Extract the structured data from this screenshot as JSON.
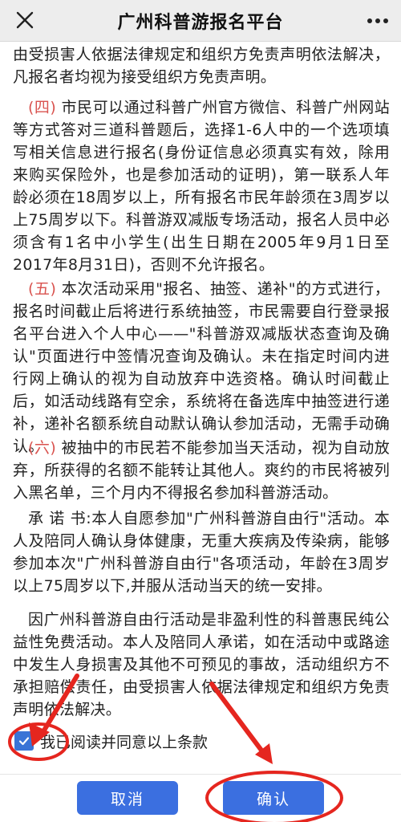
{
  "header": {
    "title": "广州科普游报名平台",
    "close_icon": "close-icon",
    "more_icon": "more-icon"
  },
  "content": {
    "p0": "由受损害人依据法律规定和组织方免责声明依法解决，凡报名者均视为接受组织方免责声明。",
    "p4_num": "(四)",
    "p4": " 市民可以通过科普广州官方微信、科普广州网站等方式答对三道科普题后，选择1-6人中的一个选项填写相关信息进行报名(身份证信息必须真实有效，除用来购买保险外，也是参加活动的证明)，第一联系人年龄必须在18周岁以上，所有报名市民年龄须在3周岁以上75周岁以下。科普游双减版专场活动，报名人员中必须含有1名中小学生(出生日期在2005年9月1日至2017年8月31日)，否则不允许报名。",
    "p5_num": "(五)",
    "p5": " 本次活动采用\"报名、抽签、递补\"的方式进行，报名时间截止后将进行系统抽签，市民需要自行登录报名平台进入个人中心——\"科普游双减版状态查询及确认\"页面进行中签情况查询及确认。未在指定时间内进行网上确认的视为自动放弃中选资格。确认时间截止后，如活动线路有空余，系统将在备选库中抽签进行递补，递补名额系统自动默认确认参加活动，无需手动确认。",
    "p6_num": "(六)",
    "p6": " 被抽中的市民若不能参加当天活动，视为自动放弃，所获得的名额不能转让其他人。爽约的市民将被列入黑名单，三个月内不得报名参加科普游活动。",
    "pledge": "承 诺 书:本人自愿参加\"广州科普游自由行\"活动。本人及陪同人确认身体健康，无重大疾病及传染病，能够参加本次\"广州科普游自由行\"各项活动，年龄在3周岁以上75周岁以下,并服从活动当天的统一安排。",
    "disclaimer": "因广州科普游自由行活动是非盈利性的科普惠民纯公益性免费活动。本人及陪同人承诺，如在活动中或路途中发生人身损害及其他不可预见的事故，活动组织方不承担赔偿责任，由受损害人依据法律规定和组织方免责声明依法解决。"
  },
  "agree": {
    "checked": true,
    "label": "我已阅读并同意以上条款"
  },
  "footer": {
    "cancel_label": "取消",
    "confirm_label": "确认"
  },
  "colors": {
    "accent": "#3b6fe0",
    "number_red": "#d9534f",
    "annotation_red": "#e5261f"
  }
}
